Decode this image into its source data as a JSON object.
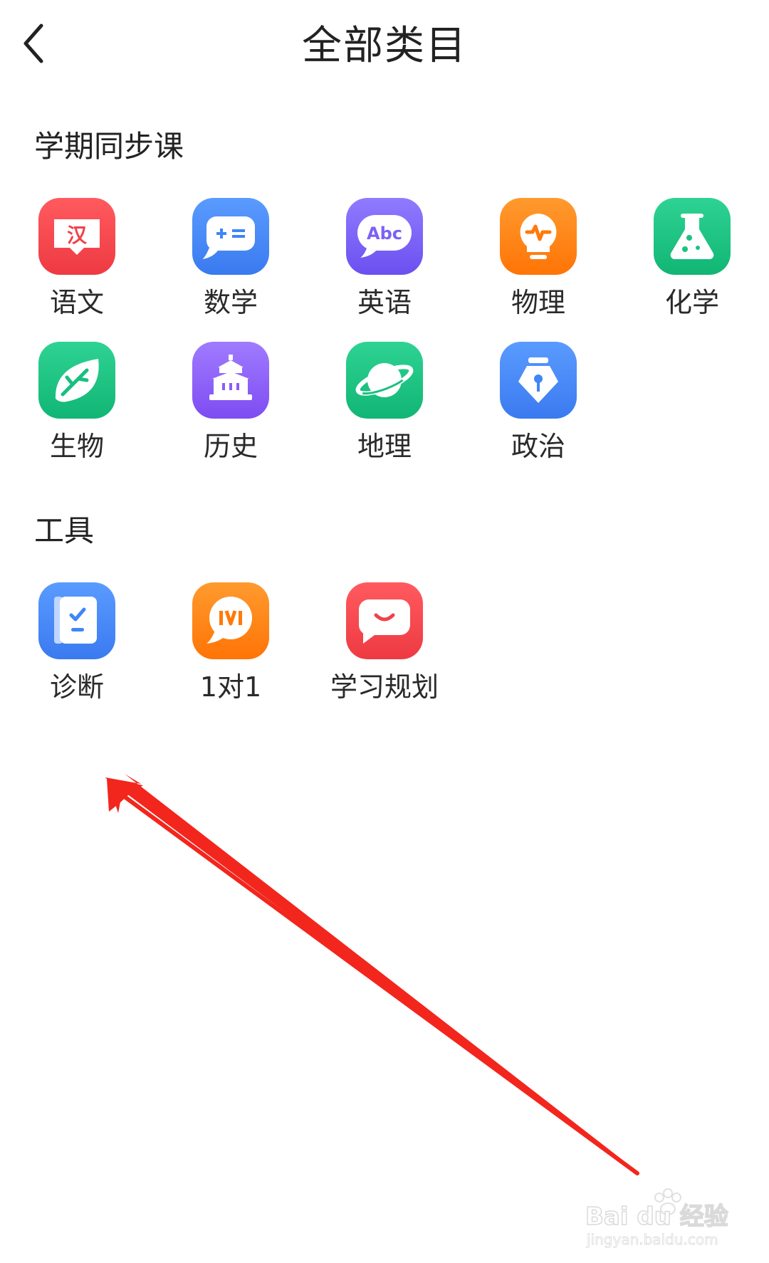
{
  "header": {
    "title": "全部类目",
    "back_icon": "chevron-left-icon"
  },
  "sections": {
    "sync": {
      "title": "学期同步课",
      "items": [
        {
          "label": "语文",
          "icon": "chinese-book-icon",
          "color": "#F4474C"
        },
        {
          "label": "数学",
          "icon": "math-operators-icon",
          "color": "#3F86F6"
        },
        {
          "label": "英语",
          "icon": "abc-bubble-icon",
          "color": "#7B61F7"
        },
        {
          "label": "物理",
          "icon": "lightbulb-pulse-icon",
          "color": "#FF7A0A"
        },
        {
          "label": "化学",
          "icon": "flask-icon",
          "color": "#18C47F"
        },
        {
          "label": "生物",
          "icon": "leaf-icon",
          "color": "#17C080"
        },
        {
          "label": "历史",
          "icon": "temple-icon",
          "color": "#8D5CF6"
        },
        {
          "label": "地理",
          "icon": "planet-icon",
          "color": "#17C080"
        },
        {
          "label": "政治",
          "icon": "pen-nib-icon",
          "color": "#3F86F6"
        }
      ]
    },
    "tools": {
      "title": "工具",
      "items": [
        {
          "label": "诊断",
          "icon": "checklist-icon",
          "color": "#3F86F6"
        },
        {
          "label": "1对1",
          "icon": "one-on-one-bubble-icon",
          "color": "#FF7A0A"
        },
        {
          "label": "学习规划",
          "icon": "smile-chat-icon",
          "color": "#F4474C"
        }
      ]
    }
  },
  "annotation": {
    "arrow_color": "#F2261D"
  },
  "watermark": {
    "brand": "Bai du 经验",
    "url": "jingyan.baidu.com"
  }
}
